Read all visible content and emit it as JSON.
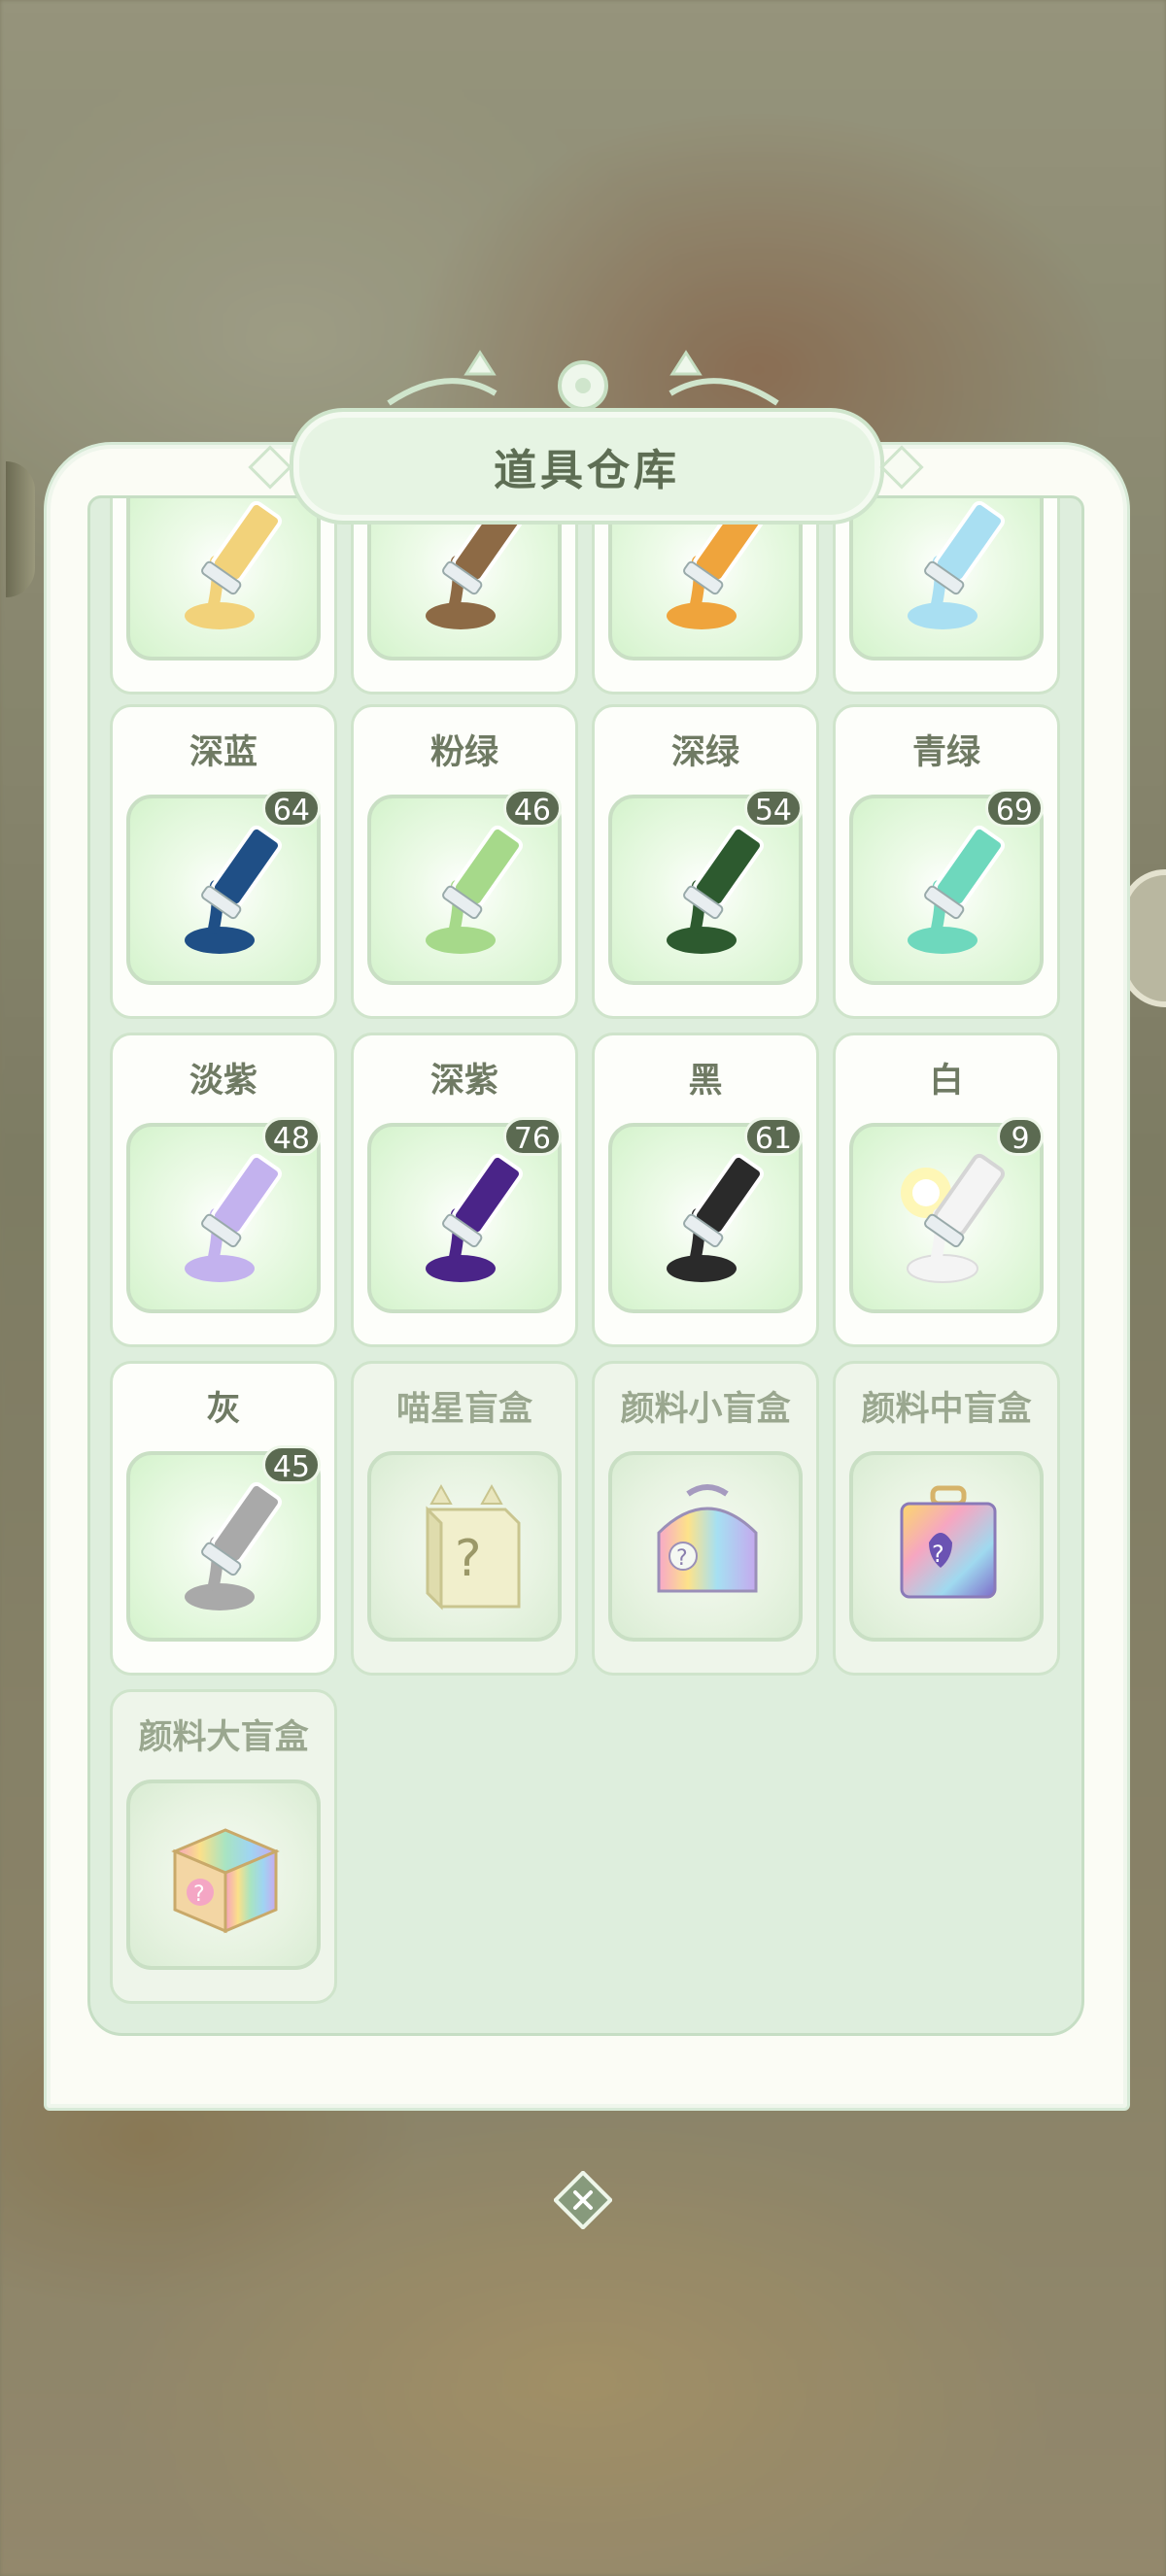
{
  "title": "道具仓库",
  "items": [
    {
      "name": "",
      "count": "",
      "color": "#f2d27a"
    },
    {
      "name": "",
      "count": "",
      "color": "#8d6a45"
    },
    {
      "name": "",
      "count": "",
      "color": "#efa43c"
    },
    {
      "name": "",
      "count": "",
      "color": "#a9dff2"
    },
    {
      "name": "深蓝",
      "count": "64",
      "color": "#1f4f86"
    },
    {
      "name": "粉绿",
      "count": "46",
      "color": "#a6d98a"
    },
    {
      "name": "深绿",
      "count": "54",
      "color": "#2d5a2f"
    },
    {
      "name": "青绿",
      "count": "69",
      "color": "#6ed8bd"
    },
    {
      "name": "淡紫",
      "count": "48",
      "color": "#c3b2ee"
    },
    {
      "name": "深紫",
      "count": "76",
      "color": "#4a2488"
    },
    {
      "name": "黑",
      "count": "61",
      "color": "#2a2a2a"
    },
    {
      "name": "白",
      "count": "9",
      "color": "#f4f4f4"
    },
    {
      "name": "灰",
      "count": "45",
      "color": "#a9a9a9"
    },
    {
      "name": "喵星盲盒",
      "icon": "cat-mystery-box-icon"
    },
    {
      "name": "颜料小盲盒",
      "icon": "rainbow-small-box-icon"
    },
    {
      "name": "颜料中盲盒",
      "icon": "rainbow-medium-box-icon"
    },
    {
      "name": "颜料大盲盒",
      "icon": "rainbow-large-box-icon"
    }
  ],
  "close_icon": "close-icon"
}
